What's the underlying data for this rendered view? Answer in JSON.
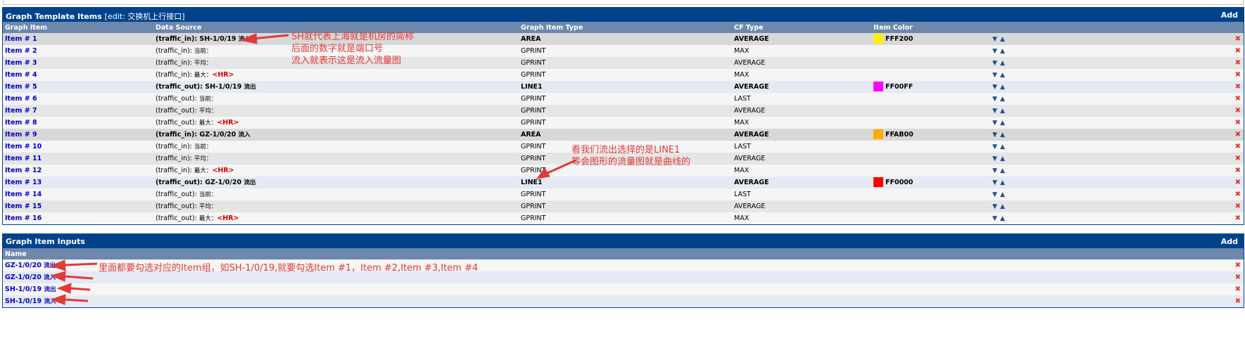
{
  "items_panel": {
    "title": "Graph Template Items",
    "subtitle": "[edit: 交换机上行接口]",
    "add": "Add",
    "columns": [
      "Graph Item",
      "Data Source",
      "Graph Item Type",
      "CF Type",
      "Item Color"
    ],
    "rows": [
      {
        "item": "Item # 1",
        "ds_name": "(traffic_in): SH-1/0/19",
        "ds_suffix": "流入",
        "hr": "",
        "type": "AREA",
        "cf": "AVERAGE",
        "color": "#FFF200",
        "hex": "FFF200",
        "bold": true
      },
      {
        "item": "Item # 2",
        "ds_name": "(traffic_in):",
        "ds_suffix": "当前：",
        "hr": "",
        "type": "GPRINT",
        "cf": "MAX",
        "color": "",
        "hex": "",
        "bold": false
      },
      {
        "item": "Item # 3",
        "ds_name": "(traffic_in):",
        "ds_suffix": "平均：",
        "hr": "",
        "type": "GPRINT",
        "cf": "AVERAGE",
        "color": "",
        "hex": "",
        "bold": false
      },
      {
        "item": "Item # 4",
        "ds_name": "(traffic_in):",
        "ds_suffix": "最大：",
        "hr": "<HR>",
        "type": "GPRINT",
        "cf": "MAX",
        "color": "",
        "hex": "",
        "bold": false
      },
      {
        "item": "Item # 5",
        "ds_name": "(traffic_out): SH-1/0/19",
        "ds_suffix": "流出",
        "hr": "",
        "type": "LINE1",
        "cf": "AVERAGE",
        "color": "#FF00FF",
        "hex": "FF00FF",
        "bold": true
      },
      {
        "item": "Item # 6",
        "ds_name": "(traffic_out):",
        "ds_suffix": "当前：",
        "hr": "",
        "type": "GPRINT",
        "cf": "LAST",
        "color": "",
        "hex": "",
        "bold": false
      },
      {
        "item": "Item # 7",
        "ds_name": "(traffic_out):",
        "ds_suffix": "平均：",
        "hr": "",
        "type": "GPRINT",
        "cf": "AVERAGE",
        "color": "",
        "hex": "",
        "bold": false
      },
      {
        "item": "Item # 8",
        "ds_name": "(traffic_out):",
        "ds_suffix": "最大：",
        "hr": "<HR>",
        "type": "GPRINT",
        "cf": "MAX",
        "color": "",
        "hex": "",
        "bold": false
      },
      {
        "item": "Item # 9",
        "ds_name": "(traffic_in): GZ-1/0/20",
        "ds_suffix": "流入",
        "hr": "",
        "type": "AREA",
        "cf": "AVERAGE",
        "color": "#FFAB00",
        "hex": "FFAB00",
        "bold": true
      },
      {
        "item": "Item # 10",
        "ds_name": "(traffic_in):",
        "ds_suffix": "当前：",
        "hr": "",
        "type": "GPRINT",
        "cf": "LAST",
        "color": "",
        "hex": "",
        "bold": false
      },
      {
        "item": "Item # 11",
        "ds_name": "(traffic_in):",
        "ds_suffix": "平均：",
        "hr": "",
        "type": "GPRINT",
        "cf": "AVERAGE",
        "color": "",
        "hex": "",
        "bold": false
      },
      {
        "item": "Item # 12",
        "ds_name": "(traffic_in):",
        "ds_suffix": "最大：",
        "hr": "<HR>",
        "type": "GPRINT",
        "cf": "MAX",
        "color": "",
        "hex": "",
        "bold": false
      },
      {
        "item": "Item # 13",
        "ds_name": "(traffic_out): GZ-1/0/20",
        "ds_suffix": "流出",
        "hr": "",
        "type": "LINE1",
        "cf": "AVERAGE",
        "color": "#FF0000",
        "hex": "FF0000",
        "bold": true
      },
      {
        "item": "Item # 14",
        "ds_name": "(traffic_out):",
        "ds_suffix": "当前：",
        "hr": "",
        "type": "GPRINT",
        "cf": "LAST",
        "color": "",
        "hex": "",
        "bold": false
      },
      {
        "item": "Item # 15",
        "ds_name": "(traffic_out):",
        "ds_suffix": "平均：",
        "hr": "",
        "type": "GPRINT",
        "cf": "AVERAGE",
        "color": "",
        "hex": "",
        "bold": false
      },
      {
        "item": "Item # 16",
        "ds_name": "(traffic_out):",
        "ds_suffix": "最大：",
        "hr": "<HR>",
        "type": "GPRINT",
        "cf": "MAX",
        "color": "",
        "hex": "",
        "bold": false
      }
    ]
  },
  "inputs_panel": {
    "title": "Graph Item Inputs",
    "add": "Add",
    "column": "Name",
    "rows": [
      {
        "name": "GZ-1/0/20",
        "suffix": "流出"
      },
      {
        "name": "GZ-1/0/20",
        "suffix": "流入"
      },
      {
        "name": "SH-1/0/19",
        "suffix": "流出"
      },
      {
        "name": "SH-1/0/19",
        "suffix": "流入"
      }
    ]
  },
  "annotations": {
    "sh_note": "SH就代表上海就是机房的简称\n后面的数字就是端口号\n流入就表示这是流入流量图",
    "line_note": "看我们流出选择的是LINE1\n等会图形的流量图就是曲线的",
    "inputs_note": "里面都要勾选对应的Item组，如SH-1/0/19,就要勾选Item #1，Item #2,Item #3,Item #4"
  },
  "icons": {
    "move_down": "arrow-down-icon",
    "move_up": "arrow-up-icon",
    "delete": "delete-x-icon"
  },
  "colors": {
    "panel_header": "#00438c",
    "column_header": "#6d88ad",
    "link": "#0000c8",
    "delete": "#e03a2b",
    "annotation": "#e03a3a"
  }
}
